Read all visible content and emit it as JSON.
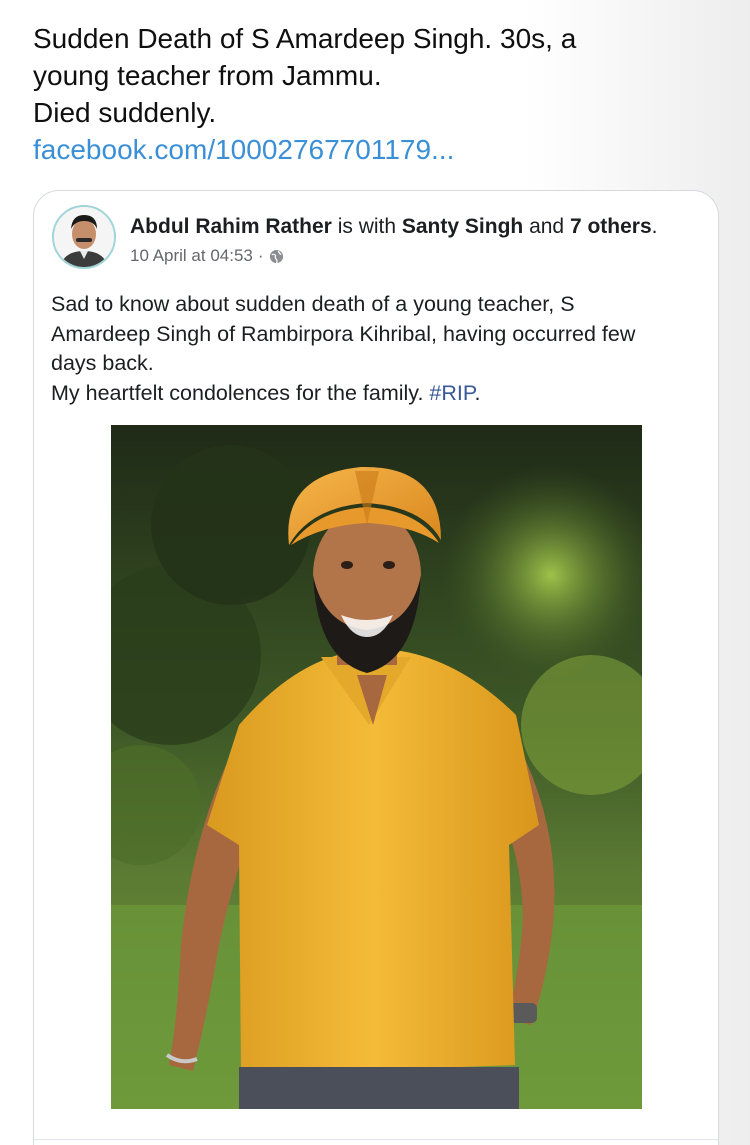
{
  "tweet": {
    "lines": [
      "Sudden Death of S Amardeep Singh. 30s, a",
      "young teacher from Jammu.",
      "Died suddenly."
    ],
    "link": "facebook.com/10002767701179..."
  },
  "fb_post": {
    "author": "Abdul Rahim Rather",
    "is_with": " is with ",
    "tagged": "Santy Singh",
    "and": " and ",
    "others": "7 others",
    "period": ".",
    "date": "10 April at 04:53",
    "separator": "·",
    "privacy_icon": "globe-icon",
    "body_lines": [
      "Sad to know about sudden death of a young teacher, S",
      "Amardeep Singh of Rambirpora Kihribal, having occurred few",
      "days back."
    ],
    "last_line_text": "My heartfelt condolences for the family. ",
    "hashtag": "#RIP",
    "last_line_end": "."
  },
  "colors": {
    "link": "#3b8fd6",
    "hashtag": "#385898",
    "turban": "#f0a233",
    "shirt": "#f2b632",
    "beard": "#1e1a17"
  }
}
